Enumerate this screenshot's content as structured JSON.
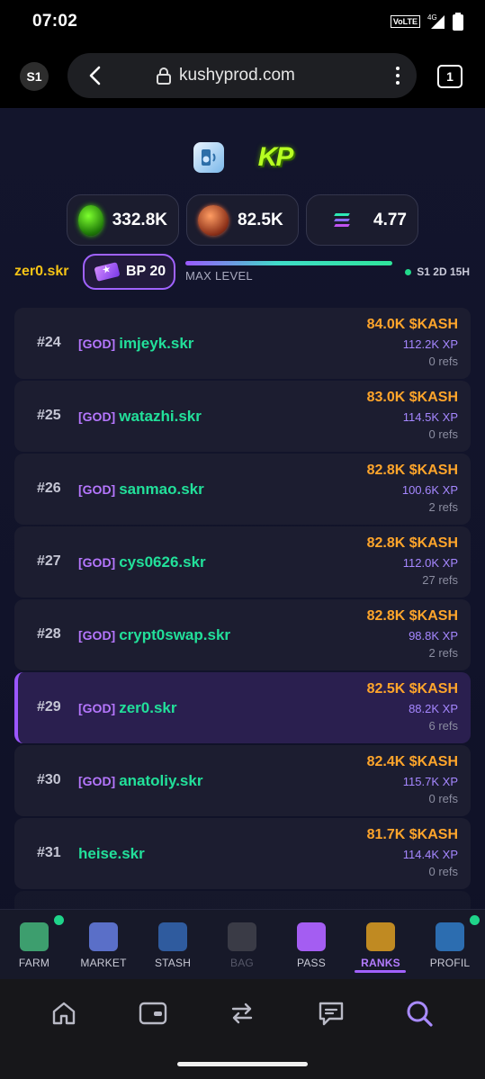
{
  "status_bar": {
    "time": "07:02",
    "volte": "VoLTE",
    "network": "4G"
  },
  "browser": {
    "profile": "S1",
    "url": "kushyprod.com",
    "tab_count": "1"
  },
  "header": {
    "logo_text": "KP",
    "stats": [
      {
        "icon": "kp-coin-icon",
        "value": "332.8K"
      },
      {
        "icon": "kash-coin-icon",
        "value": "82.5K"
      },
      {
        "icon": "solana-icon",
        "value": "4.77"
      }
    ]
  },
  "user": {
    "name": "zer0.skr",
    "battle_pass": "BP 20",
    "level_label": "MAX LEVEL",
    "level_progress": 1.0,
    "season": "S1 2D 15H"
  },
  "leaderboard": [
    {
      "rank": "#24",
      "tag": "[GOD]",
      "name": "imjeyk.skr",
      "kash": "84.0K $KASH",
      "xp": "112.2K XP",
      "refs": "0 refs",
      "me": false
    },
    {
      "rank": "#25",
      "tag": "[GOD]",
      "name": "watazhi.skr",
      "kash": "83.0K $KASH",
      "xp": "114.5K XP",
      "refs": "0 refs",
      "me": false
    },
    {
      "rank": "#26",
      "tag": "[GOD]",
      "name": "sanmao.skr",
      "kash": "82.8K $KASH",
      "xp": "100.6K XP",
      "refs": "2 refs",
      "me": false
    },
    {
      "rank": "#27",
      "tag": "[GOD]",
      "name": "cys0626.skr",
      "kash": "82.8K $KASH",
      "xp": "112.0K XP",
      "refs": "27 refs",
      "me": false
    },
    {
      "rank": "#28",
      "tag": "[GOD]",
      "name": "crypt0swap.skr",
      "kash": "82.8K $KASH",
      "xp": "98.8K XP",
      "refs": "2 refs",
      "me": false
    },
    {
      "rank": "#29",
      "tag": "[GOD]",
      "name": "zer0.skr",
      "kash": "82.5K $KASH",
      "xp": "88.2K XP",
      "refs": "6 refs",
      "me": true
    },
    {
      "rank": "#30",
      "tag": "[GOD]",
      "name": "anatoliy.skr",
      "kash": "82.4K $KASH",
      "xp": "115.7K XP",
      "refs": "0 refs",
      "me": false
    },
    {
      "rank": "#31",
      "tag": "",
      "name": "heise.skr",
      "kash": "81.7K $KASH",
      "xp": "114.4K XP",
      "refs": "0 refs",
      "me": false
    }
  ],
  "bottom_nav": [
    {
      "label": "FARM",
      "icon": "farm-icon",
      "badge": true,
      "state": "normal",
      "color": "#3d9e6e"
    },
    {
      "label": "MARKET",
      "icon": "market-icon",
      "badge": false,
      "state": "normal",
      "color": "#5a6fc8"
    },
    {
      "label": "STASH",
      "icon": "stash-icon",
      "badge": false,
      "state": "normal",
      "color": "#2f5b9e"
    },
    {
      "label": "BAG",
      "icon": "bag-icon",
      "badge": false,
      "state": "disabled",
      "color": "#3a3b46"
    },
    {
      "label": "PASS",
      "icon": "pass-icon",
      "badge": false,
      "state": "normal",
      "color": "#a45df2"
    },
    {
      "label": "RANKS",
      "icon": "ranks-icon",
      "badge": false,
      "state": "active",
      "color": "#c08a22"
    },
    {
      "label": "PROFIL",
      "icon": "profile-icon",
      "badge": true,
      "state": "normal",
      "color": "#2c6db0"
    }
  ],
  "system_nav": [
    "home-icon",
    "wallet-icon",
    "swap-icon",
    "chat-icon",
    "search-icon"
  ],
  "colors": {
    "accent": "#a262ff",
    "kash": "#ffa52b",
    "name": "#22e09a",
    "username": "#f4c316"
  }
}
